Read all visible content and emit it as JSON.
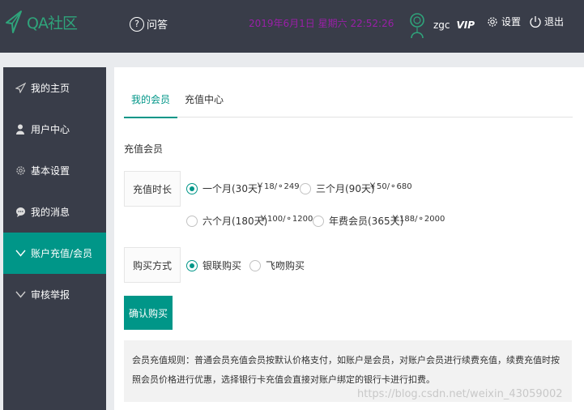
{
  "colors": {
    "header_bg": "#393d49",
    "accent": "#009688",
    "datetime": "#9a1fa8",
    "logo": "#2fa47b"
  },
  "header": {
    "logo_text": "QA社区",
    "qa_icon": "question-circle-icon",
    "qa_label": "问答",
    "datetime": "2019年6月1日 星期六 22:52:26",
    "username": "zgc",
    "vip_label": "VIP",
    "settings_label": "设置",
    "logout_label": "退出"
  },
  "sidebar": {
    "items": [
      {
        "label": "我的主页",
        "icon": "send-icon"
      },
      {
        "label": "用户中心",
        "icon": "user-icon"
      },
      {
        "label": "基本设置",
        "icon": "gear-icon"
      },
      {
        "label": "我的消息",
        "icon": "chat-bubble-icon"
      },
      {
        "label": "账户充值/会员",
        "icon": "chevron-down-icon",
        "active": true
      },
      {
        "label": "审核举报",
        "icon": "chevron-down-icon"
      }
    ]
  },
  "main": {
    "tabs": [
      {
        "label": "我的会员",
        "active": true
      },
      {
        "label": "充值中心",
        "active": false
      }
    ],
    "section_title": "充值会员",
    "duration": {
      "label": "充值时长",
      "options": [
        {
          "label": "一个月(30天)",
          "price": "￥18/",
          "coins": "249",
          "checked": true
        },
        {
          "label": "三个月(90天)",
          "price": "￥50/",
          "coins": "680",
          "checked": false
        },
        {
          "label": "六个月(180天)",
          "price": "￥100/",
          "coins": "1200",
          "checked": false
        },
        {
          "label": "年费会员(365天)",
          "price": "￥188/",
          "coins": "2000",
          "checked": false
        }
      ]
    },
    "payment": {
      "label": "购买方式",
      "options": [
        {
          "label": "银联购买",
          "checked": true
        },
        {
          "label": "飞吻购买",
          "checked": false
        }
      ]
    },
    "confirm_label": "确认购买",
    "rules_text": "会员充值规则：普通会员充值会员按默认价格支付，如账户是会员，对账户会员进行续费充值，续费充值时按照会员价格进行优惠，选择银行卡充值会直接对账户绑定的银行卡进行扣费。"
  },
  "watermark": "https://blog.csdn.net/weixin_43059002"
}
